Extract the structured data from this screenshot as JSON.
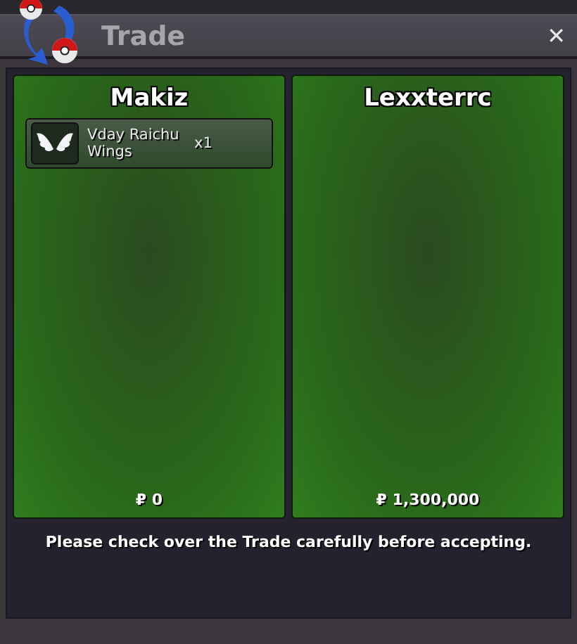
{
  "window": {
    "title": "Trade",
    "close": "✕"
  },
  "panels": [
    {
      "player": "Makiz",
      "items": [
        {
          "name": "Vday Raichu Wings",
          "quantity": "x1"
        }
      ],
      "money": "₽ 0"
    },
    {
      "player": "Lexxterrc",
      "money": "₽ 1,300,000"
    }
  ],
  "notice": "Please check over the Trade carefully before accepting."
}
